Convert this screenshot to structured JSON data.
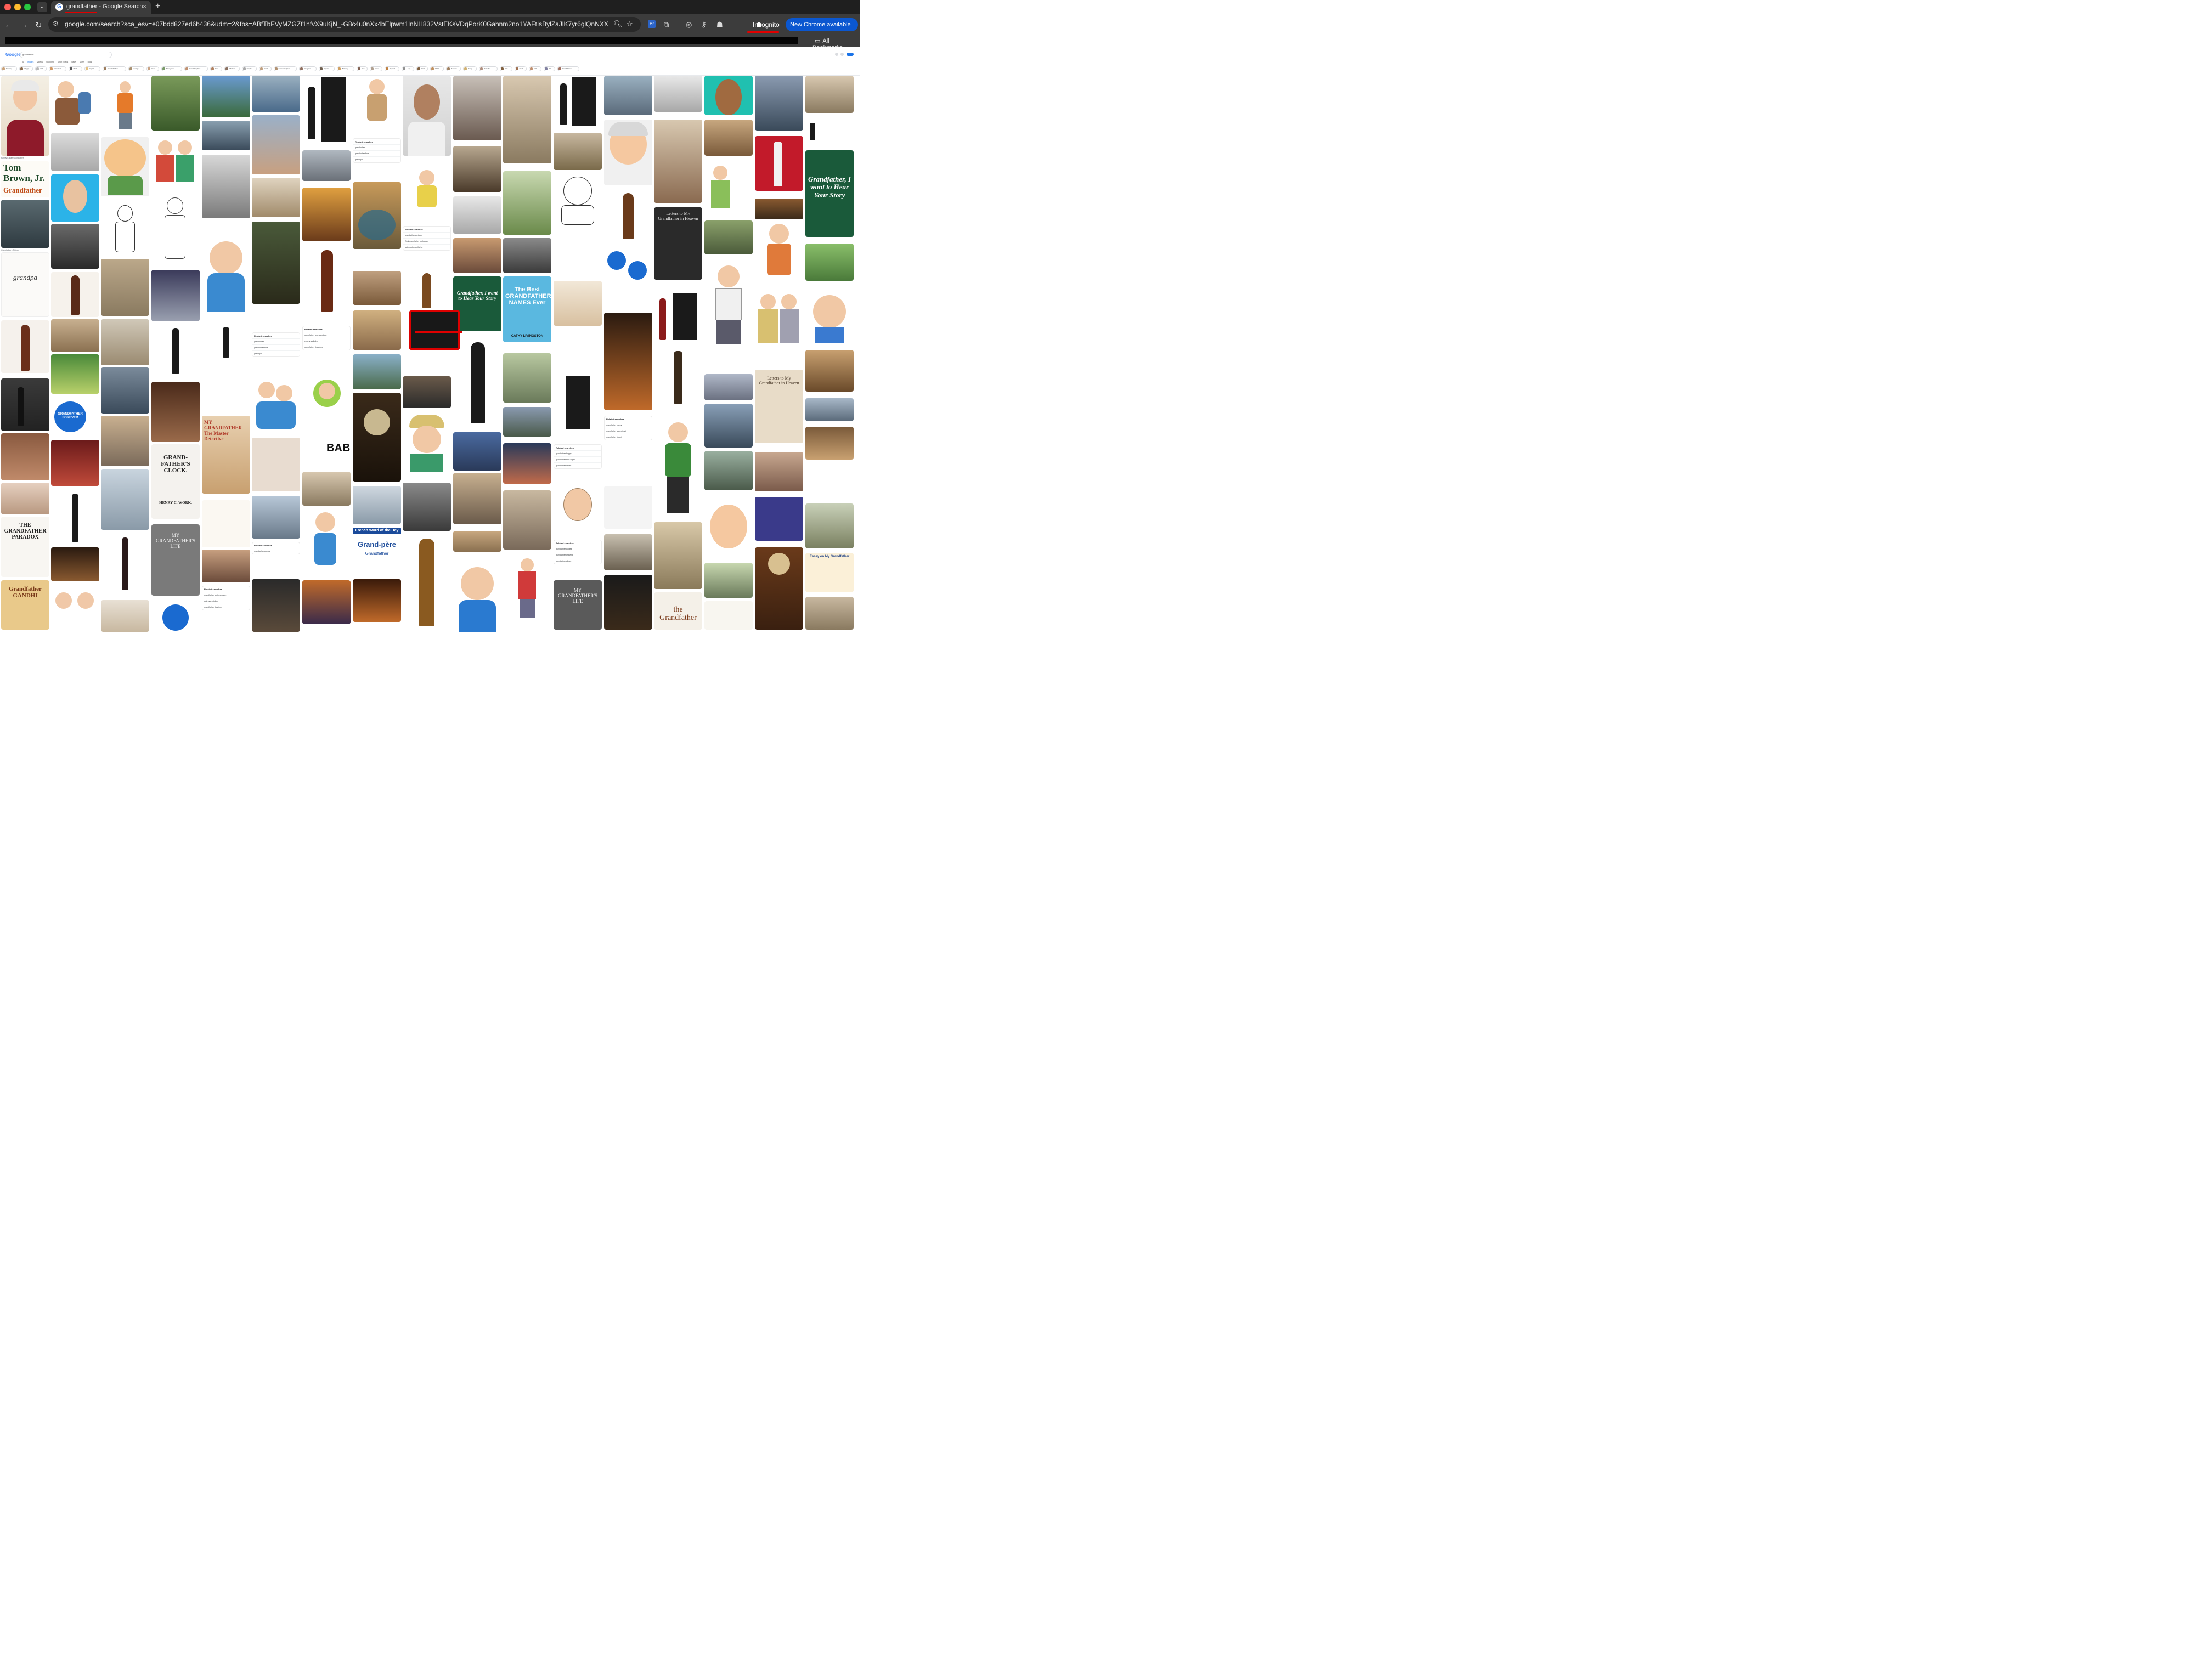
{
  "browser": {
    "tab_title": "grandfather - Google Search",
    "tab_close": "×",
    "new_tab": "+",
    "url": "google.com/search?sca_esv=e07bdd827ed6b436&udm=2&fbs=ABfTbFVyMZGZf1hfvX9uKjN_-G8c4u0nXx4bElpwm1lnNH832VstEKsVDqPorK0Gahnm2no1YAFtIsBylZaJlK7yr6glQnNXX16KI5...",
    "incognito_label": "Incognito",
    "update_label": "New Chrome available",
    "all_bookmarks": "All Bookmarks",
    "extension_badge": "Br"
  },
  "google": {
    "logo": "Google",
    "query": "grandfather",
    "tabs": [
      "All",
      "Images",
      "Videos",
      "Shopping",
      "Short videos",
      "News",
      "More",
      "Tools"
    ],
    "active_tab": "Images",
    "chips": [
      "Drawing",
      "Happy",
      "Old",
      "Animated",
      "Black",
      "Clipart",
      "Grandchildren",
      "Vintage",
      "Cute",
      "Family tree",
      "Granddaughter",
      "Face",
      "Mother",
      "Simple",
      "Hand",
      "Granddaughter",
      "Daughter",
      "Hipster",
      "Birthday",
      "Dad",
      "Good",
      "Symbol",
      "Logo",
      "Dad",
      "Child",
      "Memory",
      "Emoji",
      "Beautiful",
      "Hair",
      "Book",
      "Girl",
      "Art",
      "Grand father"
    ],
    "chip_colors": [
      "#c9a27a",
      "#8a6a4a",
      "#b8b8b8",
      "#d19a66",
      "#555",
      "#e5c07b",
      "#9b7b5b",
      "#a89070",
      "#c8a080",
      "#7a9a6a",
      "#c09070",
      "#b08060",
      "#8a7060",
      "#aaa",
      "#c0a080",
      "#b09070",
      "#907060",
      "#706050",
      "#d0a060",
      "#806050",
      "#b0a090",
      "#c08040",
      "#909090",
      "#806040",
      "#c09060",
      "#a08060",
      "#d0b070",
      "#b09080",
      "#806040",
      "#a07050",
      "#c09070",
      "#8080a0",
      "#a07060"
    ],
    "related_searches_title": "Related searches",
    "related_columns": {
      "c6": [
        "grandfather",
        "grandfather face",
        "grand pa"
      ],
      "c7": [
        "grandfather cartoon",
        "Real grandfather wallpaper",
        "awkward grandfather"
      ],
      "c5": [
        "grandfather and grandson",
        "cute grandfather",
        "grandfather drawings"
      ],
      "c11": [
        "grandfather happy",
        "grandfather face clipart",
        "grandfather clipart"
      ],
      "c4": [
        "grandfather and grandmother",
        "grandfather image",
        "grandfather clipart"
      ],
      "c10": [
        "grandfather quotes",
        "grandfather drawing",
        "grandfather clipart"
      ]
    },
    "image_texts": {
      "tom_brown": "Tom Brown, Jr.",
      "tom_brown_sub": "Grandfather",
      "tom_brown_tag": "From the Bestselling Author of The Tracker and The Vanishing Field Guide Series",
      "grandpa_card": "grandpa",
      "hear_your_story": "Grandfather, I want to Hear Your Story",
      "best_names": "The Best GRANDFATHER NAMES Ever",
      "best_names_author": "CATHY LIVINGSTON",
      "letters": "Letters to My Grandfather in Heaven",
      "my_grandfathers_life": "MY GRANDFATHER'S LIFE",
      "grandfathers_clock": "GRAND-FATHER'S CLOCK.",
      "clock_author": "HENRY C. WORK.",
      "grandfather_paradox": "THE GRANDFATHER PARADOX",
      "gandhi": "Grandfather GANDHI",
      "baba": "BABA",
      "french_word": "French Word of the Day",
      "grand_pere": "Grand-père",
      "grand_pere_en": "Grandfather",
      "master_detective": "MY GRANDFATHER The Master Detective",
      "grandfather_forever": "GRANDFATHER FOREVER",
      "the_grandfather": "the Grandfather",
      "essay": "Essay on My Grandfather",
      "mr_clay": "Grandfather",
      "grandpa_stitching": "Grandfather"
    }
  }
}
